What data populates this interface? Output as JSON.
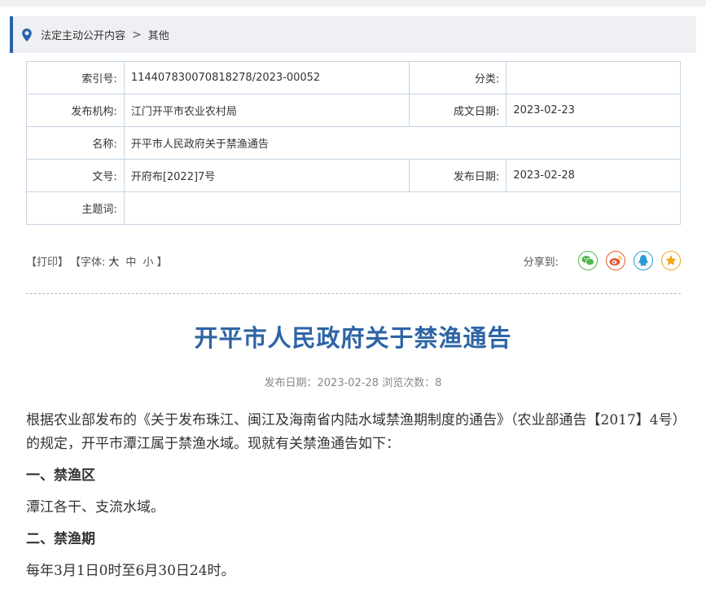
{
  "breadcrumb": {
    "link": "法定主动公开内容",
    "separator": ">",
    "current": "其他"
  },
  "meta": {
    "index_label": "索引号:",
    "index_value": "114407830070818278/2023-00052",
    "category_label": "分类:",
    "category_value": "",
    "publisher_label": "发布机构:",
    "publisher_value": "江门开平市农业农村局",
    "written_date_label": "成文日期:",
    "written_date_value": "2023-02-23",
    "name_label": "名称:",
    "name_value": "开平市人民政府关于禁渔通告",
    "doc_no_label": "文号:",
    "doc_no_value": "开府布[2022]7号",
    "publish_date_label": "发布日期:",
    "publish_date_value": "2023-02-28",
    "keywords_label": "主题词:",
    "keywords_value": ""
  },
  "tools": {
    "print": "【打印】",
    "font_prefix": "【字体:",
    "font_large": "大",
    "font_medium": "中",
    "font_small": "小",
    "font_suffix": "】",
    "share_label": "分享到:",
    "share_icons": [
      "wechat-icon",
      "weibo-icon",
      "qq-icon",
      "qzone-icon"
    ],
    "colors": {
      "wechat": "#4cb84b",
      "weibo": "#e8582c",
      "qq": "#2a9bd6",
      "qzone": "#f3a61b"
    }
  },
  "article": {
    "title": "开平市人民政府关于禁渔通告",
    "meta_line": "发布日期：2023-02-28  浏览次数：8",
    "para1": "根据农业部发布的《关于发布珠江、闽江及海南省内陆水域禁渔期制度的通告》（农业部通告【2017】4号）的规定，开平市潭江属于禁渔水域。现就有关禁渔通告如下：",
    "h1": "一、禁渔区",
    "para2": "潭江各干、支流水域。",
    "h2": "二、禁渔期",
    "para3": "每年3月1日0时至6月30日24时。"
  },
  "colors": {
    "accent": "#2a62a8",
    "title": "#2e64a5",
    "border": "#c5d5e4"
  }
}
